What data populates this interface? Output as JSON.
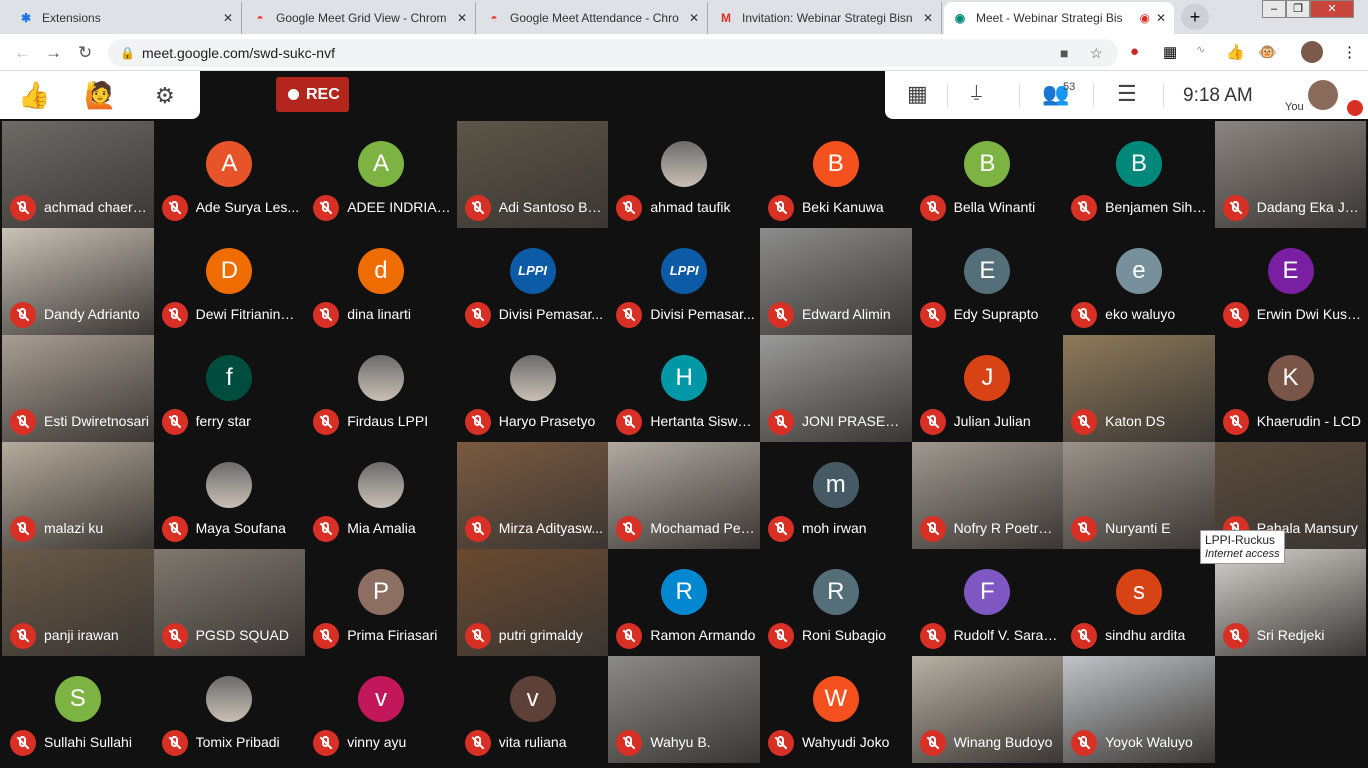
{
  "browser": {
    "tabs": [
      {
        "title": "Extensions",
        "icon": "puzzle-icon"
      },
      {
        "title": "Google Meet Grid View - Chrom",
        "icon": "chrome-store-icon"
      },
      {
        "title": "Google Meet Attendance - Chro",
        "icon": "chrome-store-icon"
      },
      {
        "title": "Invitation: Webinar Strategi Bisn",
        "icon": "gmail-icon"
      },
      {
        "title": "Meet - Webinar Strategi Bis",
        "icon": "meet-icon",
        "active": true
      }
    ],
    "url": "meet.google.com/swd-sukc-nvf"
  },
  "meet": {
    "rec_label": "REC",
    "participant_count": "53",
    "time": "9:18  AM",
    "you_label": "You",
    "accent": "#d93025"
  },
  "tooltip": {
    "title": "LPPI-Ruckus",
    "subtitle": "Internet access"
  },
  "participants": [
    {
      "name": "achmad chaeru...",
      "type": "video",
      "bg": "#6e6a66"
    },
    {
      "name": "Ade Surya Les...",
      "type": "letter",
      "letter": "A",
      "color": "#e8542a"
    },
    {
      "name": "ADEE INDRIANA",
      "type": "letter",
      "letter": "A",
      "color": "#7cb342"
    },
    {
      "name": "Adi Santoso Bu...",
      "type": "video",
      "bg": "#5d5548"
    },
    {
      "name": "ahmad taufik",
      "type": "photo"
    },
    {
      "name": "Beki Kanuwa",
      "type": "letter",
      "letter": "B",
      "color": "#f4511e"
    },
    {
      "name": "Bella Winanti",
      "type": "letter",
      "letter": "B",
      "color": "#7cb342"
    },
    {
      "name": "Benjamen Siho...",
      "type": "letter",
      "letter": "B",
      "color": "#00897b"
    },
    {
      "name": "Dadang Eka Jat...",
      "type": "video",
      "bg": "#8a8580"
    },
    {
      "name": "Dandy Adrianto",
      "type": "video",
      "bg": "#c9c2b8"
    },
    {
      "name": "Dewi Fitrianingr...",
      "type": "letter",
      "letter": "D",
      "color": "#ef6c00"
    },
    {
      "name": "dina linarti",
      "type": "letter",
      "letter": "d",
      "color": "#ef6c00"
    },
    {
      "name": "Divisi Pemasar...",
      "type": "logo",
      "letter": "LPPI"
    },
    {
      "name": "Divisi Pemasar...",
      "type": "logo",
      "letter": "LPPI"
    },
    {
      "name": "Edward Alimin",
      "type": "video",
      "bg": "#8c8c8c"
    },
    {
      "name": "Edy Suprapto",
      "type": "letter",
      "letter": "E",
      "color": "#546e7a"
    },
    {
      "name": "eko waluyo",
      "type": "letter",
      "letter": "e",
      "color": "#78909c"
    },
    {
      "name": "Erwin Dwi Kusu...",
      "type": "letter",
      "letter": "E",
      "color": "#7b1fa2"
    },
    {
      "name": "Esti Dwiretnosari",
      "type": "video",
      "bg": "#a89e94"
    },
    {
      "name": "ferry star",
      "type": "letter",
      "letter": "f",
      "color": "#004d40"
    },
    {
      "name": "Firdaus LPPI",
      "type": "photo"
    },
    {
      "name": "Haryo Prasetyo",
      "type": "photo"
    },
    {
      "name": "Hertanta Siswo...",
      "type": "letter",
      "letter": "H",
      "color": "#0097a7"
    },
    {
      "name": "JONI PRASETIY...",
      "type": "video",
      "bg": "#9a9a9a"
    },
    {
      "name": "Julian Julian",
      "type": "letter",
      "letter": "J",
      "color": "#d84315"
    },
    {
      "name": "Katon DS",
      "type": "video",
      "bg": "#8d7a5a"
    },
    {
      "name": "Khaerudin - LCD",
      "type": "letter",
      "letter": "K",
      "color": "#795548"
    },
    {
      "name": "malazi ku",
      "type": "video",
      "bg": "#b5ab9c"
    },
    {
      "name": "Maya Soufana",
      "type": "photo"
    },
    {
      "name": "Mia Amalia",
      "type": "photo"
    },
    {
      "name": "Mirza Adityasw...",
      "type": "video",
      "bg": "#7a5a40"
    },
    {
      "name": "Mochamad Pen...",
      "type": "video",
      "bg": "#b0aaa2"
    },
    {
      "name": "moh irwan",
      "type": "letter",
      "letter": "m",
      "color": "#455a64"
    },
    {
      "name": "Nofry R Poetra -...",
      "type": "video",
      "bg": "#a09890"
    },
    {
      "name": "Nuryanti E",
      "type": "video",
      "bg": "#9a928a"
    },
    {
      "name": "Pahala Mansury",
      "type": "video",
      "bg": "#5a4a3a"
    },
    {
      "name": "panji irawan",
      "type": "video",
      "bg": "#6a5a48"
    },
    {
      "name": "PGSD SQUAD",
      "type": "video",
      "bg": "#807870"
    },
    {
      "name": "Prima Firiasari",
      "type": "letter",
      "letter": "P",
      "color": "#8d6e63"
    },
    {
      "name": "putri grimaldy",
      "type": "video",
      "bg": "#6a4a30"
    },
    {
      "name": "Ramon Armando",
      "type": "letter",
      "letter": "R",
      "color": "#0288d1"
    },
    {
      "name": "Roni Subagio",
      "type": "letter",
      "letter": "R",
      "color": "#546e7a"
    },
    {
      "name": "Rudolf V. Saragi...",
      "type": "letter",
      "letter": "F",
      "color": "#7e57c2"
    },
    {
      "name": "sindhu ardita",
      "type": "letter",
      "letter": "s",
      "color": "#d84315"
    },
    {
      "name": "Sri Redjeki",
      "type": "video",
      "bg": "#d8d4cf"
    },
    {
      "name": "Sullahi Sullahi",
      "type": "letter",
      "letter": "S",
      "color": "#7cb342"
    },
    {
      "name": "Tomix Pribadi",
      "type": "photo"
    },
    {
      "name": "vinny ayu",
      "type": "letter",
      "letter": "v",
      "color": "#c2185b"
    },
    {
      "name": "vita ruliana",
      "type": "letter",
      "letter": "v",
      "color": "#5d4037"
    },
    {
      "name": "Wahyu B.",
      "type": "video",
      "bg": "#8a8a88"
    },
    {
      "name": "Wahyudi Joko",
      "type": "letter",
      "letter": "W",
      "color": "#f4511e"
    },
    {
      "name": "Winang Budoyo",
      "type": "video",
      "bg": "#b8b0a4"
    },
    {
      "name": "Yoyok Waluyo",
      "type": "video",
      "bg": "#c0c4c8"
    }
  ]
}
